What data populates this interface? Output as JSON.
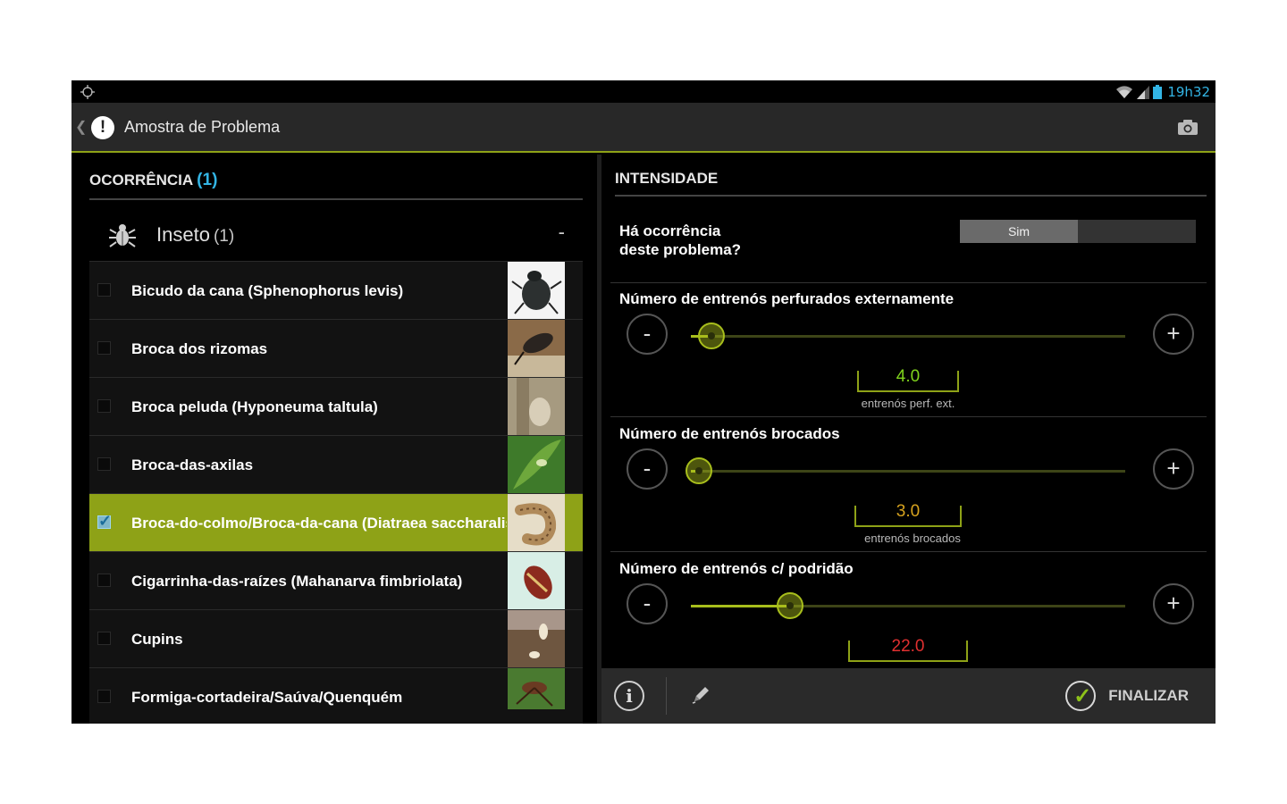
{
  "statusbar": {
    "time": "19h32",
    "left_icon": "target-icon",
    "right_icons": [
      "wifi-icon",
      "signal-icon",
      "battery-icon"
    ]
  },
  "actionbar": {
    "title": "Amostra de Problema",
    "up_icon": "chevron-left-icon",
    "logo_icon": "exclamation-icon",
    "logo_glyph": "!",
    "action_icon": "camera-icon"
  },
  "left": {
    "header_title": "OCORRÊNCIA",
    "header_count": "(1)",
    "group": {
      "label": "Inseto",
      "count": "(1)",
      "collapse": "-",
      "icon": "bug-icon"
    },
    "items": [
      {
        "label": "Bicudo da cana (Sphenophorus levis)",
        "checked": false
      },
      {
        "label": "Broca dos rizomas",
        "checked": false
      },
      {
        "label": "Broca peluda (Hyponeuma taltula)",
        "checked": false
      },
      {
        "label": "Broca-das-axilas",
        "checked": false
      },
      {
        "label": "Broca-do-colmo/Broca-da-cana (Diatraea saccharalis)",
        "checked": true
      },
      {
        "label": "Cigarrinha-das-raízes (Mahanarva fimbriolata)",
        "checked": false
      },
      {
        "label": "Cupins",
        "checked": false
      },
      {
        "label": "Formiga-cortadeira/Saúva/Quenquém",
        "checked": false
      }
    ]
  },
  "right": {
    "header_title": "INTENSIDADE",
    "occurrence_line1": "Há ocorrência",
    "occurrence_line2": "deste problema?",
    "toggle_value": "Sim",
    "sliders": [
      {
        "title": "Número de entrenós perfurados externamente",
        "value": "4.0",
        "unit": "entrenós perf. ext.",
        "value_color": "#7fd21c",
        "fraction": 0.04
      },
      {
        "title": "Número de entrenós brocados",
        "value": "3.0",
        "unit": "entrenós brocados",
        "value_color": "#d6a21e",
        "fraction": 0.01
      },
      {
        "title": "Número de entrenós c/ podridão",
        "value": "22.0",
        "unit": "",
        "value_color": "#e03030",
        "fraction": 0.22
      }
    ],
    "minus_label": "-",
    "plus_label": "+"
  },
  "bottombar": {
    "info_label": "i",
    "edit_icon": "pencil-icon",
    "finalize_label": "FINALIZAR",
    "finalize_icon": "check-circle-icon"
  }
}
